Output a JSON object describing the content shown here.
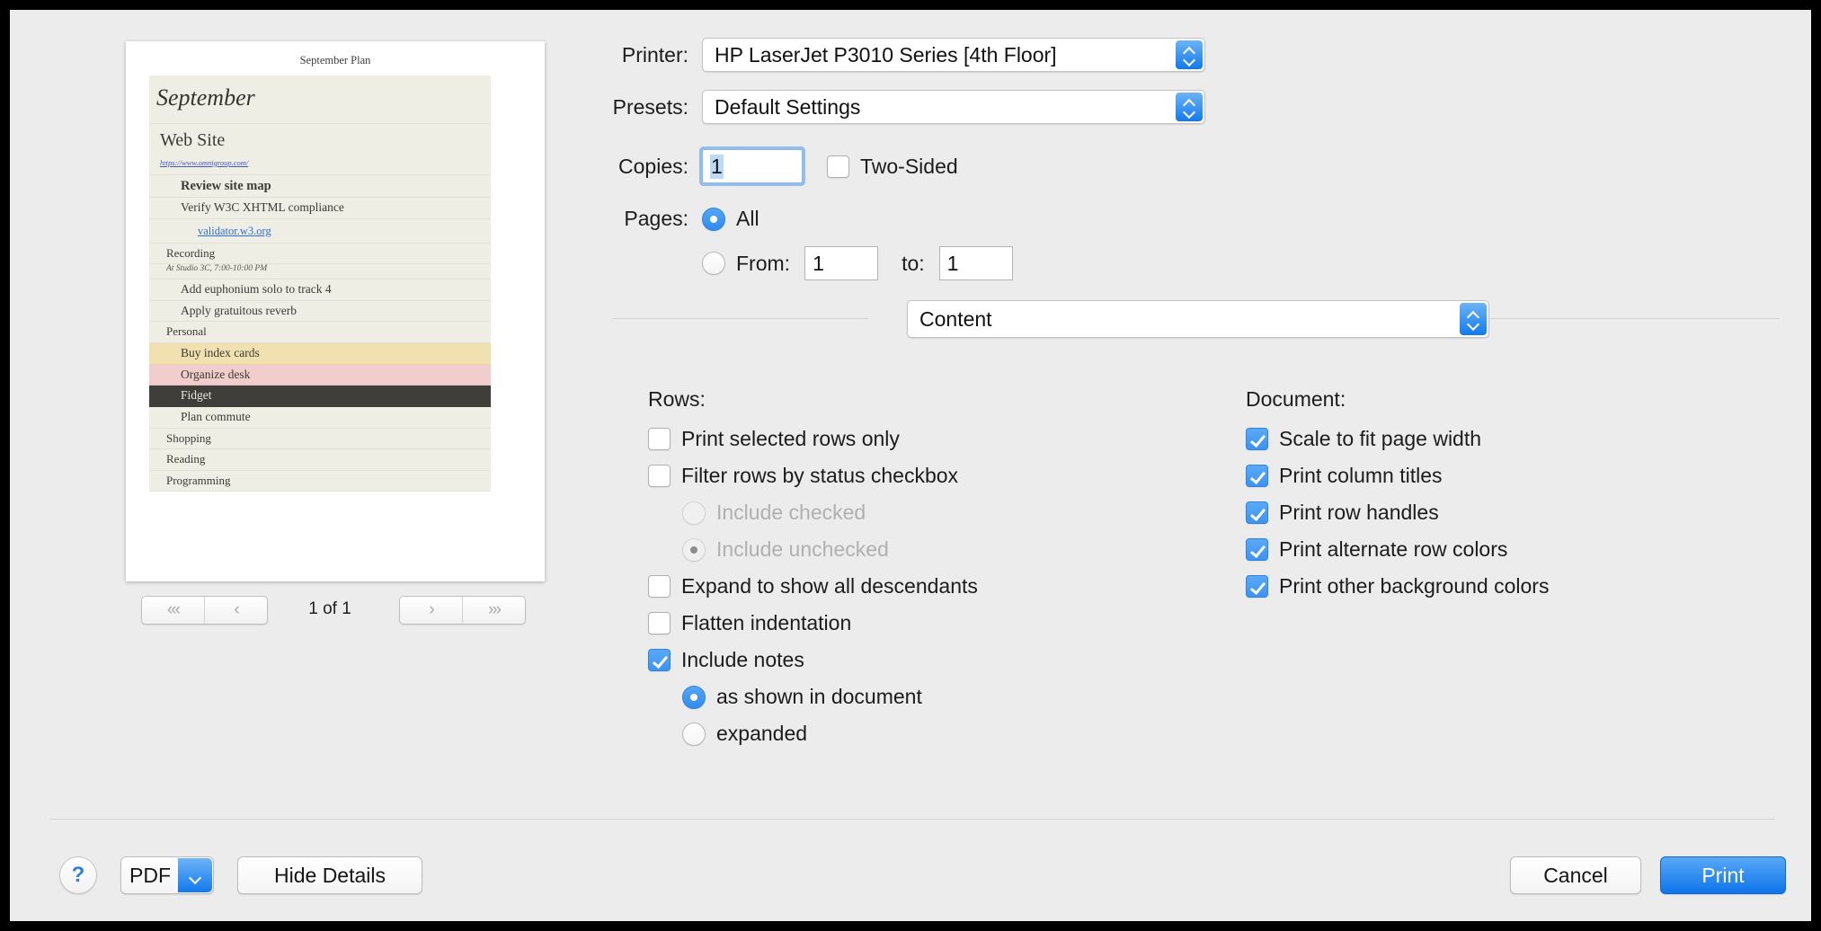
{
  "preview": {
    "document_header": "September Plan",
    "rows": [
      {
        "text": "September",
        "style": "title"
      },
      {
        "text": "Web Site",
        "style": "h1"
      },
      {
        "text": "https://www.omnigroup.com/",
        "style": "url"
      },
      {
        "text": "Review site map",
        "style": "bold"
      },
      {
        "text": "Verify W3C XHTML compliance",
        "style": "lvl2"
      },
      {
        "text": "validator.w3.org",
        "style": "link"
      },
      {
        "text": "Recording",
        "style": "lvl1"
      },
      {
        "text": "At Studio 3C, 7:00-10:00 PM",
        "style": "note"
      },
      {
        "text": "Add euphonium solo to track 4",
        "style": "lvl2"
      },
      {
        "text": "Apply gratuitous reverb",
        "style": "lvl2"
      },
      {
        "text": "Personal",
        "style": "lvl1"
      },
      {
        "text": "Buy index cards",
        "style": "lvl2-yellow"
      },
      {
        "text": "Organize desk",
        "style": "lvl2-pink"
      },
      {
        "text": "Fidget",
        "style": "lvl2-dark"
      },
      {
        "text": "Plan commute",
        "style": "lvl2"
      },
      {
        "text": "Shopping",
        "style": "lvl1"
      },
      {
        "text": "Reading",
        "style": "lvl1"
      },
      {
        "text": "Programming",
        "style": "lvl1"
      }
    ],
    "pager": {
      "first_label": "«‹",
      "prev_label": "‹",
      "next_label": "›",
      "last_label": "›»",
      "page_count": "1 of 1"
    }
  },
  "settings": {
    "printer_label": "Printer:",
    "printer_value": "HP LaserJet P3010 Series [4th Floor]",
    "presets_label": "Presets:",
    "presets_value": "Default Settings",
    "copies_label": "Copies:",
    "copies_value": "1",
    "two_sided_label": "Two-Sided",
    "two_sided_checked": false,
    "pages_label": "Pages:",
    "pages_all_label": "All",
    "pages_all_selected": true,
    "pages_from_label": "From:",
    "pages_from_value": "1",
    "pages_to_label": "to:",
    "pages_to_value": "1",
    "pane_selector_value": "Content"
  },
  "rows_group": {
    "title": "Rows:",
    "options": [
      {
        "label": "Print selected rows only",
        "checked": false,
        "disabled": false
      },
      {
        "label": "Filter rows by status checkbox",
        "checked": false,
        "disabled": false
      }
    ],
    "filter_radios": [
      {
        "label": "Include checked",
        "selected": false,
        "disabled": true
      },
      {
        "label": "Include unchecked",
        "selected": true,
        "disabled": true
      }
    ],
    "options2": [
      {
        "label": "Expand to show all descendants",
        "checked": false,
        "disabled": false
      },
      {
        "label": "Flatten indentation",
        "checked": false,
        "disabled": false
      },
      {
        "label": "Include notes",
        "checked": true,
        "disabled": false
      }
    ],
    "notes_radios": [
      {
        "label": "as shown in document",
        "selected": true,
        "disabled": false
      },
      {
        "label": "expanded",
        "selected": false,
        "disabled": false
      }
    ]
  },
  "document_group": {
    "title": "Document:",
    "options": [
      {
        "label": "Scale to fit page width",
        "checked": true
      },
      {
        "label": "Print column titles",
        "checked": true
      },
      {
        "label": "Print row handles",
        "checked": true
      },
      {
        "label": "Print alternate row colors",
        "checked": true
      },
      {
        "label": "Print other background colors",
        "checked": true
      }
    ]
  },
  "bottom_bar": {
    "help_label": "?",
    "pdf_label": "PDF",
    "hide_details_label": "Hide Details",
    "cancel_label": "Cancel",
    "print_label": "Print"
  },
  "colors": {
    "accent_blue": "#1279ec",
    "window_bg": "#ececec",
    "doc_row_bg": "#efeee4",
    "highlight_yellow": "#f2e1b0",
    "highlight_pink": "#f2cdcd",
    "highlight_dark": "#3f3e3b",
    "link_blue": "#2f6fd0"
  }
}
